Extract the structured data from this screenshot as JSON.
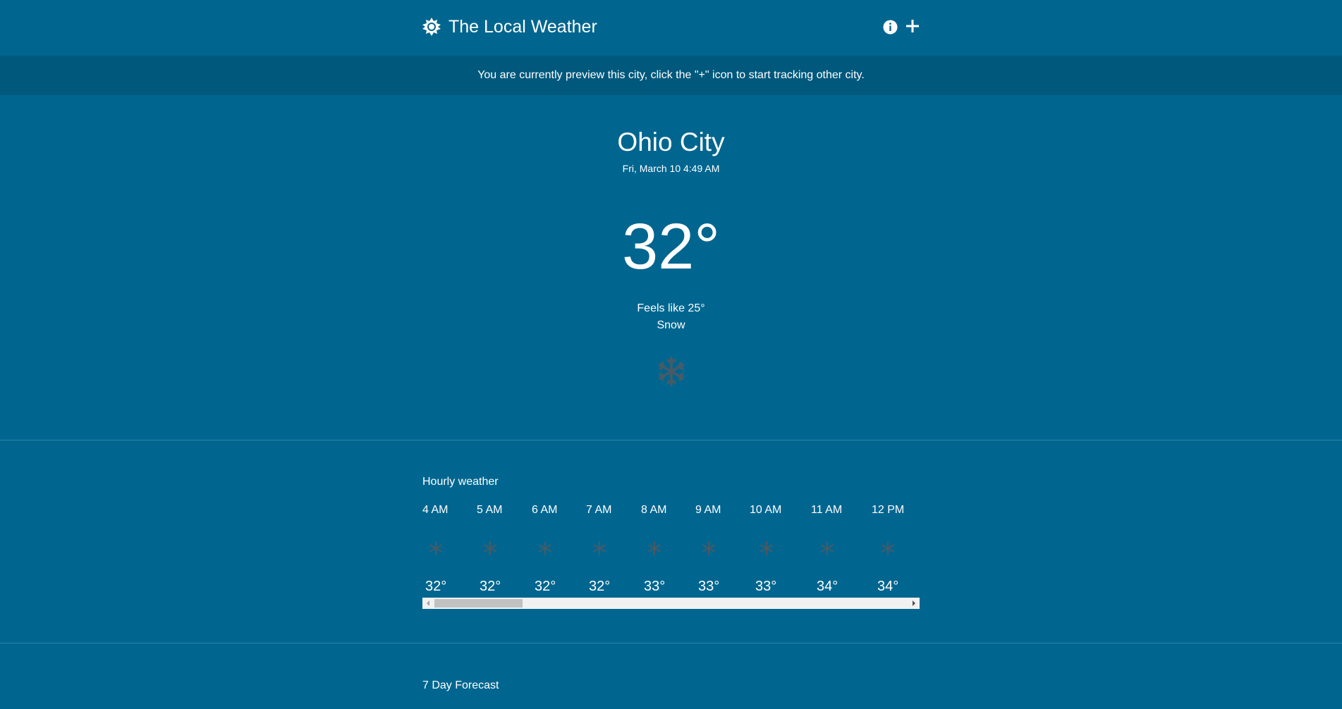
{
  "header": {
    "title": "The Local Weather",
    "brand_icon": "sun-icon",
    "info_icon": "info-icon",
    "add_icon": "plus-icon"
  },
  "banner": {
    "text": "You are currently preview this city, click the \"+\" icon to start tracking other city."
  },
  "current": {
    "city": "Ohio City",
    "datetime": "Fri, March 10 4:49 AM",
    "temperature": "32°",
    "feels_like": "Feels like 25°",
    "condition": "Snow",
    "icon": "snowflake-icon"
  },
  "hourly": {
    "title": "Hourly weather",
    "items": [
      {
        "time": "4 AM",
        "temp": "32°",
        "icon": "snowflake-icon"
      },
      {
        "time": "5 AM",
        "temp": "32°",
        "icon": "snowflake-icon"
      },
      {
        "time": "6 AM",
        "temp": "32°",
        "icon": "snowflake-icon"
      },
      {
        "time": "7 AM",
        "temp": "32°",
        "icon": "snowflake-icon"
      },
      {
        "time": "8 AM",
        "temp": "33°",
        "icon": "snowflake-icon"
      },
      {
        "time": "9 AM",
        "temp": "33°",
        "icon": "snowflake-icon"
      },
      {
        "time": "10 AM",
        "temp": "33°",
        "icon": "snowflake-icon"
      },
      {
        "time": "11 AM",
        "temp": "34°",
        "icon": "snowflake-icon"
      },
      {
        "time": "12 PM",
        "temp": "34°",
        "icon": "snowflake-icon"
      }
    ]
  },
  "forecast": {
    "title": "7 Day Forecast"
  },
  "colors": {
    "background": "#006690",
    "banner": "#00587c",
    "divider": "#2b84a8",
    "icon": "#4a5a64"
  }
}
